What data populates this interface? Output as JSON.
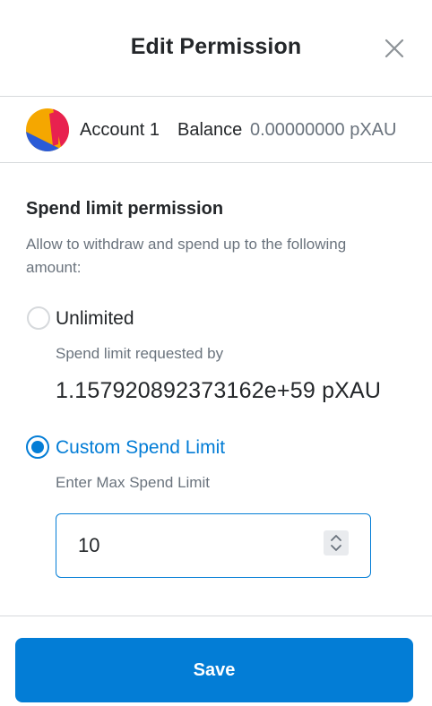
{
  "header": {
    "title": "Edit Permission",
    "close_icon": "close-icon"
  },
  "account": {
    "name": "Account 1",
    "balance_label": "Balance",
    "balance_value": "0.00000000 pXAU",
    "avatar_colors": [
      "#f5a700",
      "#e8214f",
      "#2a5bd7",
      "#f5a700"
    ]
  },
  "permission": {
    "title": "Spend limit permission",
    "description": "Allow to withdraw and spend up to the following amount:",
    "options": [
      {
        "label": "Unlimited",
        "selected": false,
        "sub_label": "Spend limit requested by",
        "amount": "1.157920892373162e+59 pXAU"
      },
      {
        "label": "Custom Spend Limit",
        "selected": true,
        "sub_label": "Enter Max Spend Limit",
        "input_value": "10"
      }
    ]
  },
  "footer": {
    "save_label": "Save"
  },
  "colors": {
    "accent": "#037dd6",
    "text_primary": "#24272a",
    "text_muted": "#6a737d",
    "border": "#d6d9dc"
  }
}
